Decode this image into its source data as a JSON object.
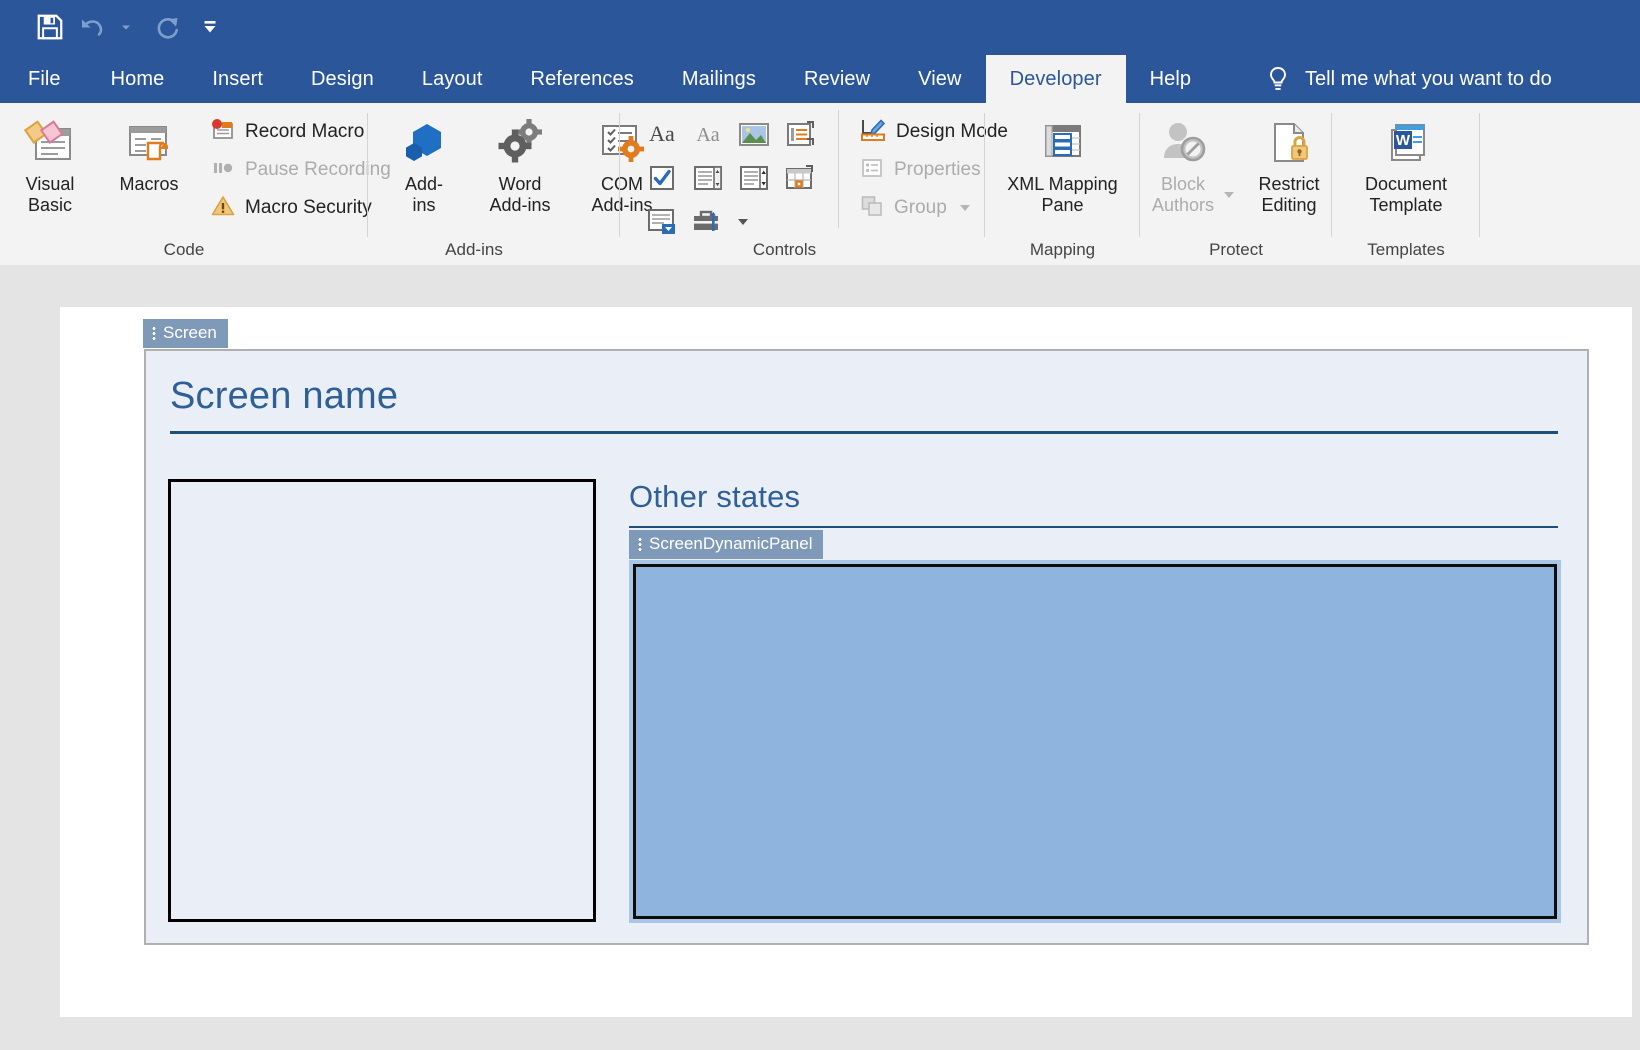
{
  "quick_access": {
    "items": [
      {
        "name": "save-icon",
        "label": "Save"
      },
      {
        "name": "undo-icon",
        "label": "Undo"
      },
      {
        "name": "redo-icon",
        "label": "Repeat"
      },
      {
        "name": "customize-qat-icon",
        "label": "Customize Quick Access Toolbar"
      }
    ]
  },
  "ribbon": {
    "tabs": [
      {
        "label": "File",
        "active": false
      },
      {
        "label": "Home",
        "active": false
      },
      {
        "label": "Insert",
        "active": false
      },
      {
        "label": "Design",
        "active": false
      },
      {
        "label": "Layout",
        "active": false
      },
      {
        "label": "References",
        "active": false
      },
      {
        "label": "Mailings",
        "active": false
      },
      {
        "label": "Review",
        "active": false
      },
      {
        "label": "View",
        "active": false
      },
      {
        "label": "Developer",
        "active": true
      },
      {
        "label": "Help",
        "active": false
      }
    ],
    "tell_me": "Tell me what you want to do",
    "groups": [
      {
        "label": "Code",
        "big_buttons": [
          {
            "label": "Visual\nBasic",
            "icon": "visual-basic-icon"
          },
          {
            "label": "Macros",
            "icon": "macros-icon"
          }
        ],
        "small_buttons": [
          {
            "label": "Record Macro",
            "icon": "record-macro-icon",
            "disabled": false
          },
          {
            "label": "Pause Recording",
            "icon": "pause-recording-icon",
            "disabled": true
          },
          {
            "label": "Macro Security",
            "icon": "macro-security-icon",
            "disabled": false
          }
        ]
      },
      {
        "label": "Add-ins",
        "big_buttons": [
          {
            "label": "Add-\nins",
            "icon": "add-ins-icon"
          },
          {
            "label": "Word\nAdd-ins",
            "icon": "word-add-ins-icon"
          },
          {
            "label": "COM\nAdd-ins",
            "icon": "com-add-ins-icon"
          }
        ]
      },
      {
        "label": "Controls",
        "grid_icons": [
          "rich-text-content-control-icon",
          "plain-text-content-control-icon",
          "picture-content-control-icon",
          "building-block-gallery-content-control-icon",
          "check-box-content-control-icon",
          "combo-box-content-control-icon",
          "drop-down-list-content-control-icon",
          "date-picker-content-control-icon",
          "repeating-section-content-control-icon",
          "legacy-tools-icon"
        ],
        "small_buttons": [
          {
            "label": "Design Mode",
            "icon": "design-mode-icon",
            "disabled": false
          },
          {
            "label": "Properties",
            "icon": "properties-icon",
            "disabled": true
          },
          {
            "label": "Group",
            "icon": "group-icon",
            "disabled": true,
            "has_caret": true
          }
        ]
      },
      {
        "label": "Mapping",
        "big_buttons": [
          {
            "label": "XML Mapping\nPane",
            "icon": "xml-mapping-pane-icon"
          }
        ]
      },
      {
        "label": "Protect",
        "big_buttons": [
          {
            "label": "Block\nAuthors",
            "icon": "block-authors-icon",
            "disabled": true,
            "has_caret": true
          },
          {
            "label": "Restrict\nEditing",
            "icon": "restrict-editing-icon",
            "disabled": false
          }
        ]
      },
      {
        "label": "Templates",
        "big_buttons": [
          {
            "label": "Document\nTemplate",
            "icon": "document-template-icon"
          }
        ]
      }
    ]
  },
  "document": {
    "screen_control": {
      "tag": "Screen",
      "title": "Screen name",
      "other_states_heading": "Other states",
      "dynamic_panel": {
        "tag": "ScreenDynamicPanel"
      }
    }
  },
  "colors": {
    "ribbon_blue": "#2b579a",
    "ribbon_face": "#f3f3f3",
    "heading_blue": "#2e5f96",
    "rule_blue": "#1f4e79",
    "content_control_tag": "#7e9ab8",
    "content_control_fill": "#e9eef7",
    "selection_fill": "#8fb4de",
    "selection_border": "#a9c6e6",
    "canvas_gray": "#e4e4e4"
  }
}
